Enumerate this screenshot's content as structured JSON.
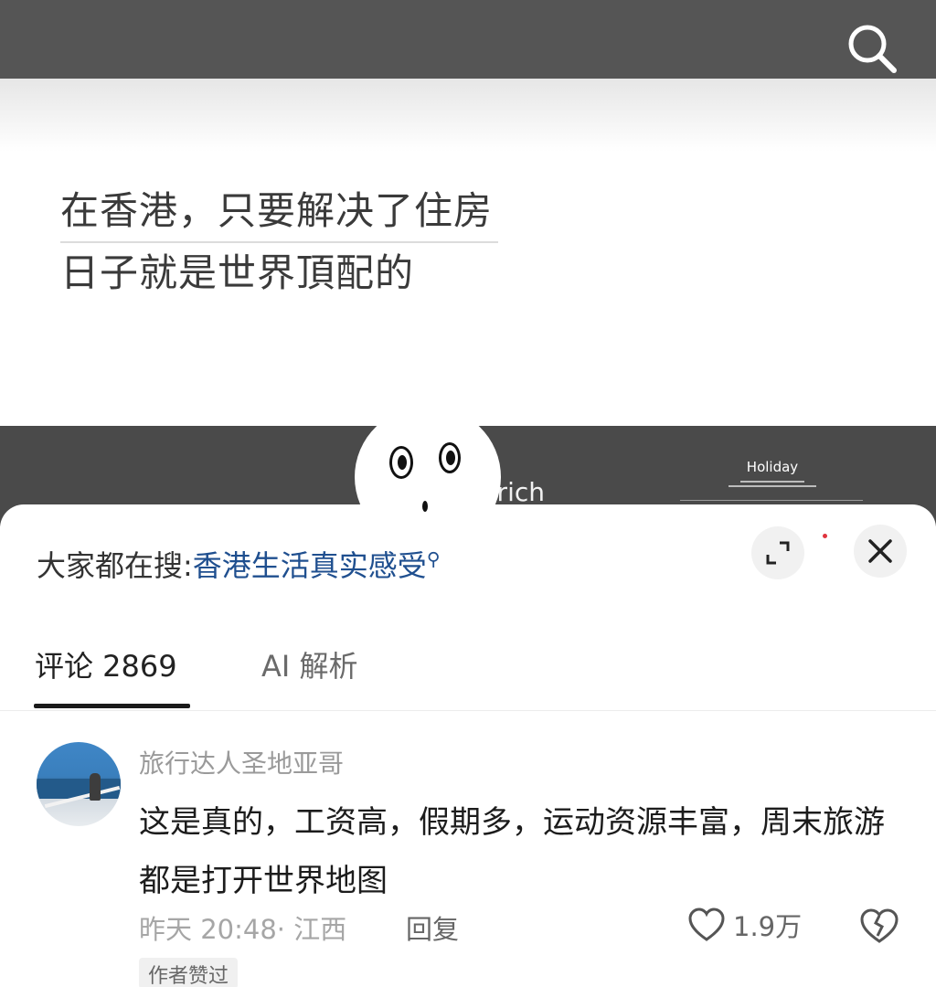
{
  "video": {
    "caption_line1": "在香港，只要解决了住房",
    "caption_line2": "日子就是世界頂配的",
    "handle_fragment": "iirich",
    "overlay_label": "Holiday"
  },
  "icons": {
    "search": "search-icon",
    "sticker": "face-sticker-icon",
    "expand": "expand-icon",
    "close": "close-icon",
    "like": "heart-icon",
    "dislike": "broken-heart-icon"
  },
  "colors": {
    "topbar": "#555555",
    "keyword_link": "#1f4f8f",
    "notification_dot": "#e0343e"
  },
  "search_suggest": {
    "prefix": "大家都在搜:",
    "keyword": "香港生活真实感受",
    "search_glyph": "⚲"
  },
  "tabs": [
    {
      "label": "评论 2869"
    },
    {
      "label": "AI 解析"
    }
  ],
  "comment": {
    "author": "旅行达人圣地亚哥",
    "text": "这是真的，工资高，假期多，运动资源丰富，周末旅游都是打开世界地图",
    "time_location": "昨天 20:48· 江西",
    "reply_label": "回复",
    "like_count": "1.9万",
    "author_liked_badge": "作者赞过"
  }
}
